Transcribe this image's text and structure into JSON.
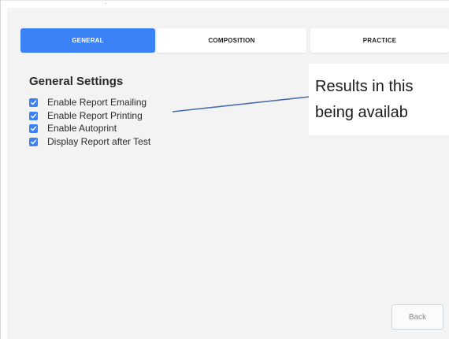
{
  "tabs": [
    {
      "label": "GENERAL",
      "active": true
    },
    {
      "label": "COMPOSITION",
      "active": false
    },
    {
      "label": "PRACTICE",
      "active": false
    }
  ],
  "settings": {
    "title": "General Settings",
    "options": [
      {
        "label": "Enable Report Emailing",
        "checked": true
      },
      {
        "label": "Enable Report Printing",
        "checked": true
      },
      {
        "label": "Enable Autoprint",
        "checked": true
      },
      {
        "label": "Display Report after Test",
        "checked": true
      }
    ]
  },
  "back_button": {
    "label": "Back"
  },
  "callout": {
    "line1": "Results in this",
    "line2": "being availab"
  },
  "colors": {
    "accent": "#3b82f6",
    "panel_bg": "#f3f3f3",
    "callout_line": "#4a6fa8"
  }
}
